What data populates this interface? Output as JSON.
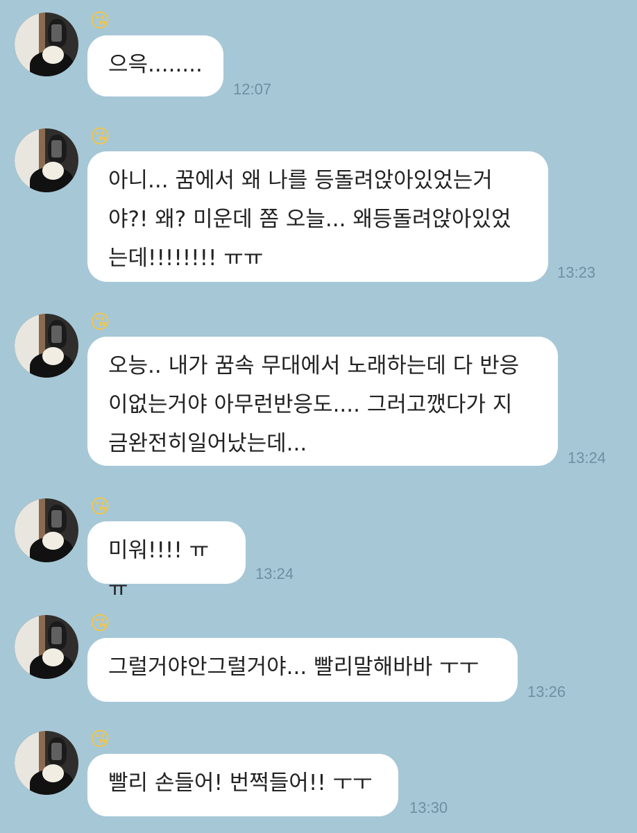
{
  "messages": [
    {
      "emoji": "😘",
      "text": "으윽........",
      "time": "12:07"
    },
    {
      "emoji": "😘",
      "text": "아니... 꿈에서 왜 나를 등돌려앉아있었는거\n야?! 왜? 미운데 쫌 오늘... 왜등돌려앉아있었\n는데!!!!!!!! ㅠㅠ",
      "time": "13:23"
    },
    {
      "emoji": "😘",
      "text": "오능.. 내가 꿈속 무대에서 노래하는데 다 반응\n이없는거야 아무런반응도.... 그러고깼다가 지\n금완전히일어났는데...",
      "time": "13:24"
    },
    {
      "emoji": "😘",
      "text": "미워!!!! ㅠㅠ",
      "time": "13:24"
    },
    {
      "emoji": "😘",
      "text": "그럴거야안그럴거야... 빨리말해바바 ㅜㅜ",
      "time": "13:26"
    },
    {
      "emoji": "😘",
      "text": "빨리 손들어! 번쩍들어!! ㅜㅜ",
      "time": "13:30"
    }
  ]
}
